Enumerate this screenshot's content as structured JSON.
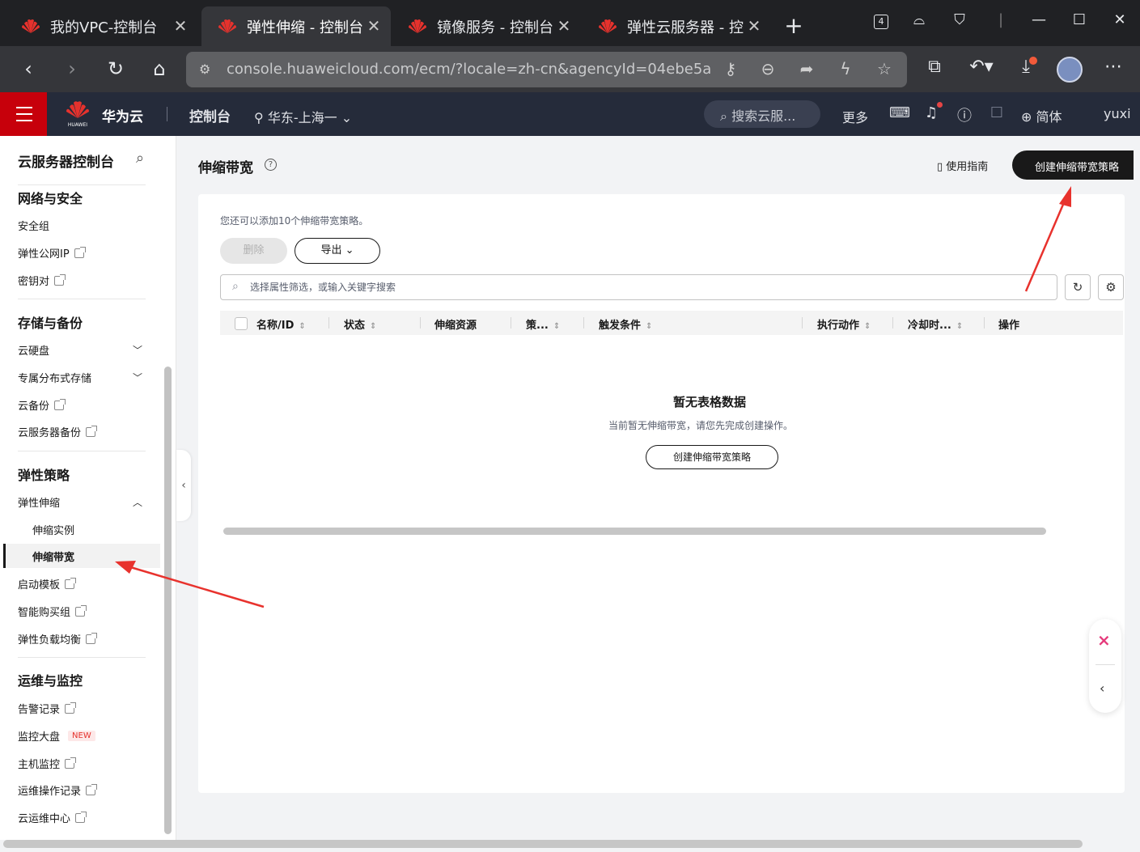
{
  "browser": {
    "tabs": [
      {
        "title": "我的VPC-控制台",
        "close": "✕"
      },
      {
        "title": "弹性伸缩 - 控制台",
        "close": "✕"
      },
      {
        "title": "镜像服务 - 控制台",
        "close": "✕"
      },
      {
        "title": "弹性云服务器 - 控",
        "close": "✕"
      }
    ],
    "new_tab": "+",
    "tab_count": "4",
    "url": "console.huaweicloud.com/ecm/?locale=zh-cn&agencyId=04ebe5a..."
  },
  "header": {
    "brand": "华为云",
    "logo_text": "HUAWEI",
    "console": "控制台",
    "region": "华东-上海一",
    "search": "搜索云服...",
    "more": "更多",
    "language": "简体",
    "user": "yuxi"
  },
  "sidebar": {
    "title": "云服务器控制台",
    "groups": [
      {
        "label": "网络与安全",
        "items": [
          "安全组",
          "弹性公网IP",
          "密钥对"
        ]
      },
      {
        "label": "存储与备份",
        "items": [
          "云硬盘",
          "专属分布式存储",
          "云备份",
          "云服务器备份"
        ]
      },
      {
        "label": "弹性策略",
        "items": [
          "弹性伸缩",
          "伸缩实例",
          "伸缩带宽",
          "启动模板",
          "智能购买组",
          "弹性负载均衡"
        ]
      },
      {
        "label": "运维与监控",
        "items": [
          "告警记录",
          "监控大盘",
          "主机监控",
          "运维操作记录",
          "云运维中心"
        ]
      }
    ],
    "new_badge": "NEW"
  },
  "main": {
    "title": "伸缩带宽",
    "guide_link": "使用指南",
    "create_button": "创建伸缩带宽策略",
    "quota_tip": "您还可以添加10个伸缩带宽策略。",
    "delete_button": "删除",
    "export_button": "导出",
    "filter_placeholder": "选择属性筛选，或输入关键字搜索",
    "columns": [
      "名称/ID",
      "状态",
      "伸缩资源",
      "策...",
      "触发条件",
      "执行动作",
      "冷却时...",
      "操作"
    ],
    "empty_title": "暂无表格数据",
    "empty_desc": "当前暂无伸缩带宽，请您先完成创建操作。",
    "empty_create": "创建伸缩带宽策略"
  },
  "colors": {
    "brand_red": "#c7000b",
    "header_bg": "#252b3a",
    "annotation_arrow": "#e8322d"
  }
}
